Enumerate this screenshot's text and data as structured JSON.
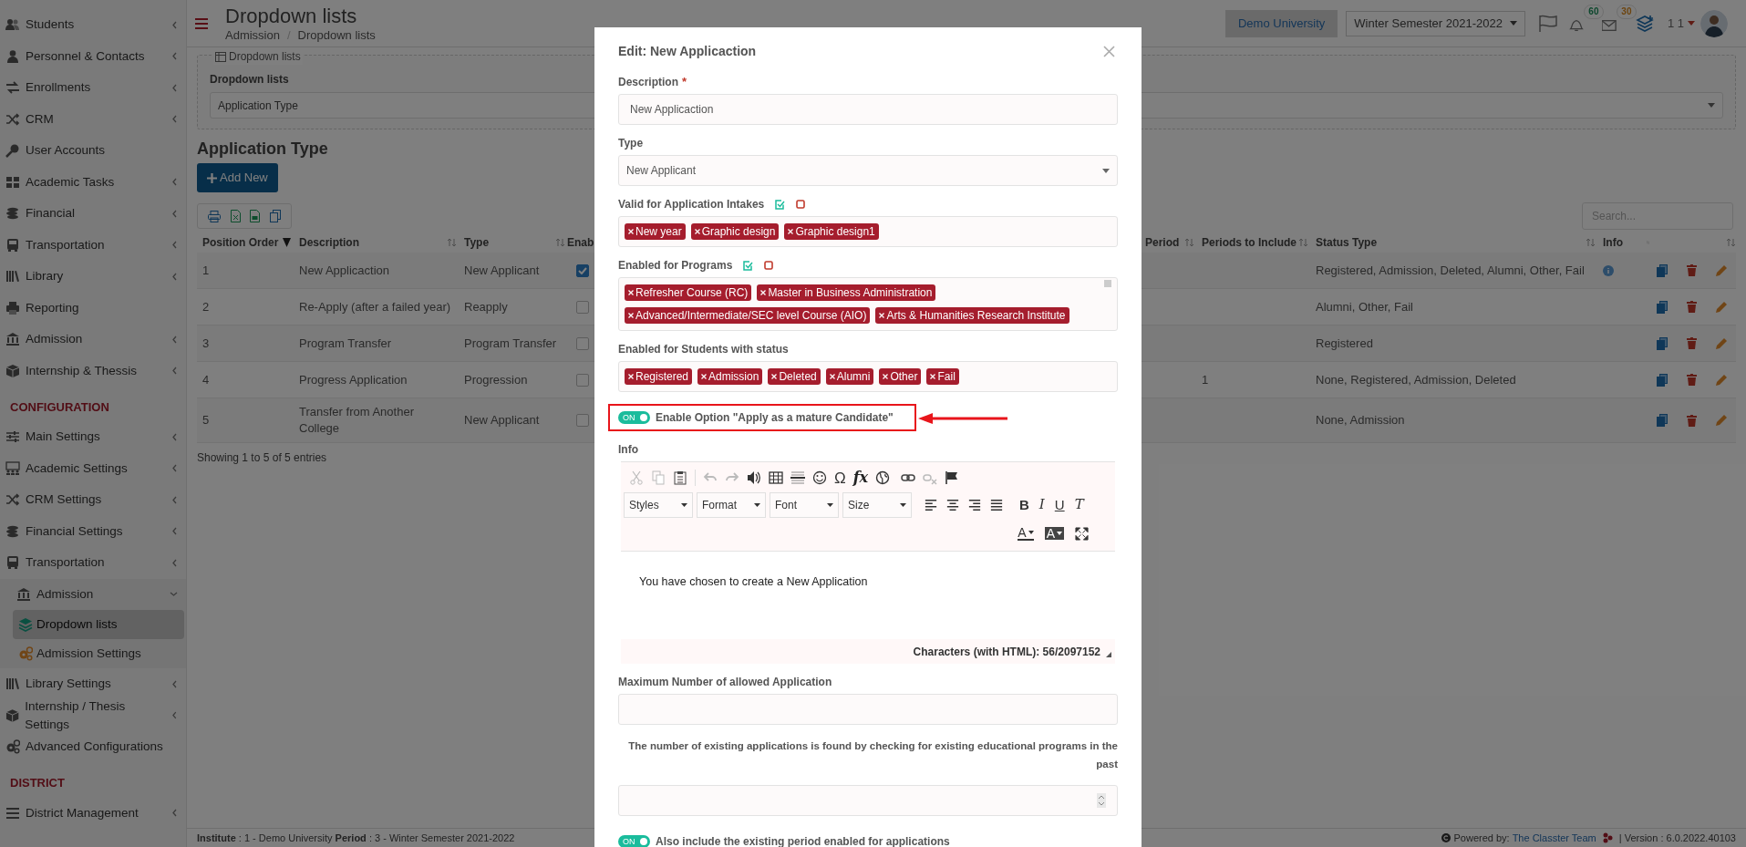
{
  "sidebar": [
    {
      "kind": "item",
      "label": "Students",
      "expandable": true,
      "expanded": false
    },
    {
      "kind": "item",
      "label": "Personnel & Contacts",
      "expandable": true,
      "expanded": false
    },
    {
      "kind": "item",
      "label": "Enrollments",
      "expandable": true,
      "expanded": false
    },
    {
      "kind": "item",
      "label": "CRM",
      "expandable": true,
      "expanded": false
    },
    {
      "kind": "item",
      "label": "User Accounts",
      "expandable": false,
      "expanded": false
    },
    {
      "kind": "item",
      "label": "Academic Tasks",
      "expandable": true,
      "expanded": false
    },
    {
      "kind": "item",
      "label": "Financial",
      "expandable": true,
      "expanded": false
    },
    {
      "kind": "item",
      "label": "Transportation",
      "expandable": true,
      "expanded": false
    },
    {
      "kind": "item",
      "label": "Library",
      "expandable": true,
      "expanded": false
    },
    {
      "kind": "item",
      "label": "Reporting",
      "expandable": false,
      "expanded": false
    },
    {
      "kind": "item",
      "label": "Admission",
      "expandable": true,
      "expanded": false
    },
    {
      "kind": "item",
      "label": "Internship & Thessis",
      "expandable": true,
      "expanded": false
    },
    {
      "kind": "heading",
      "label": "CONFIGURATION"
    },
    {
      "kind": "item",
      "label": "Main Settings",
      "expandable": true,
      "expanded": false
    },
    {
      "kind": "item",
      "label": "Academic Settings",
      "expandable": true,
      "expanded": false
    },
    {
      "kind": "item",
      "label": "CRM Settings",
      "expandable": true,
      "expanded": false
    },
    {
      "kind": "item",
      "label": "Financial Settings",
      "expandable": true,
      "expanded": false
    },
    {
      "kind": "item",
      "label": "Transportation",
      "expandable": true,
      "expanded": false
    },
    {
      "kind": "item",
      "label": "Admission",
      "expandable": true,
      "expanded": true,
      "children": [
        {
          "label": "Dropdown lists",
          "selected": true
        },
        {
          "label": "Admission Settings",
          "selected": false
        }
      ]
    },
    {
      "kind": "item",
      "label": "Library Settings",
      "expandable": true,
      "expanded": false
    },
    {
      "kind": "item",
      "label": "Internship / Thesis Settings",
      "expandable": true,
      "expanded": false
    },
    {
      "kind": "item",
      "label": "Advanced Configurations",
      "expandable": false,
      "expanded": false
    },
    {
      "kind": "heading",
      "label": "DISTRICT"
    },
    {
      "kind": "item",
      "label": "District Management",
      "expandable": true,
      "expanded": false
    }
  ],
  "header": {
    "title": "Dropdown lists",
    "breadcrumb": [
      "Admission",
      "Dropdown lists"
    ],
    "breadcrumb_separator": "/",
    "institution": "Demo University",
    "semester": "Winter Semester 2021-2022",
    "notifications": "60",
    "messages": "30",
    "user": "1 1"
  },
  "panel": {
    "legend": "Dropdown lists",
    "label": "Dropdown lists",
    "value": "Application Type"
  },
  "section_title": "Application Type",
  "add_button": "Add New",
  "search": {
    "placeholder": "Search..."
  },
  "table": {
    "columns": [
      {
        "label": "Position Order",
        "sorted": true
      },
      {
        "label": "Description",
        "sorted": false
      },
      {
        "label": "Type",
        "sorted": false
      },
      {
        "label": "Enab"
      },
      {
        "label": "Period",
        "sorted": false
      },
      {
        "label": "Periods to Include",
        "sorted": false
      },
      {
        "label": "Status Type",
        "sorted": false
      },
      {
        "label": "Info",
        "sorted": false
      }
    ],
    "rows": [
      {
        "order": "1",
        "description": "New Applicaction",
        "type": "New Applicant",
        "enabled": true,
        "status": "Registered, Admission, Deleted, Alumni, Other, Fail",
        "info": true
      },
      {
        "order": "2",
        "description": "Re-Apply (after a failed year)",
        "type": "Reapply",
        "enabled": false,
        "status": "Alumni, Other, Fail",
        "info": false
      },
      {
        "order": "3",
        "description": "Program Transfer",
        "type": "Program Transfer",
        "enabled": false,
        "status": "Registered",
        "info": false
      },
      {
        "order": "4",
        "description": "Progress Application",
        "type": "Progression",
        "enabled": false,
        "periods": "1",
        "status": "None, Registered, Admission, Deleted",
        "info": false
      },
      {
        "order": "5",
        "description": "Transfer from Another College",
        "type": "New Applicant",
        "enabled": false,
        "status": "None, Admission",
        "info": false
      }
    ]
  },
  "table_info": "Showing 1 to 5 of 5 entries",
  "footer": {
    "context": "**Institute** : 1 - Demo University **Period** : 3 - Winter Semester 2021-2022",
    "powered": "Powered by:",
    "team": "The Classter Team",
    "version": "| Version : 6.0.2022.40103"
  },
  "modal": {
    "title": "Edit: New Applicaction",
    "fields": [
      {
        "kind": "text",
        "label": "Description",
        "required_mark": "*",
        "value": "New Applicaction"
      },
      {
        "kind": "select",
        "label": "Type",
        "value": "New Applicant"
      },
      {
        "kind": "tags",
        "label": "Valid for Application Intakes",
        "tags": [
          "New year",
          "Graphic design",
          "Graphic design1"
        ]
      },
      {
        "kind": "tags",
        "label": "Enabled for Programs",
        "tags": [
          "Refresher Course (RC)",
          "Master in Business Administration",
          "Advanced/Intermediate/SEC level Course (AIO)",
          "Arts & Humanities Research Institute"
        ]
      },
      {
        "kind": "tags",
        "label": "Enabled for Students with status",
        "tags": [
          "Registered",
          "Admission",
          "Deleted",
          "Alumni",
          "Other",
          "Fail"
        ]
      },
      {
        "kind": "toggle",
        "label": "Enable Option \"Apply as a mature Candidate\"",
        "on": true,
        "switch_text": "ON",
        "highlighted": true
      },
      {
        "kind": "editor",
        "label": "Info",
        "symbols": [
          "Ω",
          "fx"
        ],
        "dropdowns": [
          "Styles",
          "Format",
          "Font",
          "Size"
        ],
        "styles": [
          "B",
          "I",
          "U",
          "T"
        ],
        "colors": [
          "A",
          "A"
        ],
        "text": "You have chosen to create a New Application",
        "counter": "Characters (with HTML): 56/2097152"
      },
      {
        "kind": "text",
        "label": "Maximum Number of allowed Application"
      },
      {
        "kind": "note",
        "text": "The number of existing applications is found by checking for existing educational programs in the past"
      },
      {
        "kind": "number"
      },
      {
        "kind": "toggle",
        "label": "Also include the existing period enabled for applications",
        "on": true,
        "switch_text": "ON",
        "highlighted": false
      }
    ]
  }
}
